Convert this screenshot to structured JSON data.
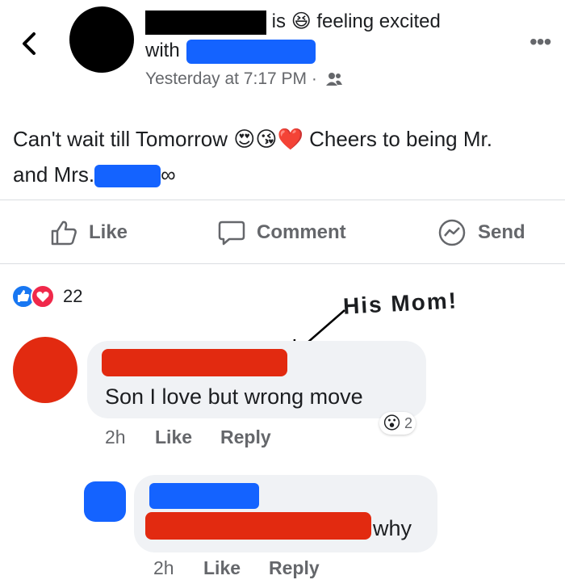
{
  "header": {
    "status_verb": "is",
    "status_emoji": "😆",
    "feeling": "feeling excited",
    "with_label": "with",
    "timestamp": "Yesterday at 7:17 PM ·",
    "audience_icon": "friends-icon",
    "more_icon": "•••"
  },
  "post": {
    "text_1": "Can't wait till Tomorrow",
    "emojis": "😍😘❤️",
    "text_2": "Cheers to being Mr.",
    "text_3": "and Mrs.",
    "infinity": "∞"
  },
  "actions": {
    "like": "Like",
    "comment": "Comment",
    "send": "Send"
  },
  "reactions": {
    "count": "22"
  },
  "annotation": "His Mom!",
  "comments": [
    {
      "text": "Son I love but wrong move",
      "time": "2h",
      "like": "Like",
      "reply": "Reply",
      "reaction_emoji": "😮",
      "reaction_count": "2"
    },
    {
      "text": "why",
      "time": "2h",
      "like": "Like",
      "reply": "Reply"
    }
  ],
  "colors": {
    "redact_blue": "#1463ff",
    "redact_red": "#e22a10",
    "meta_gray": "#65676b",
    "bubble_bg": "#f0f2f5"
  }
}
